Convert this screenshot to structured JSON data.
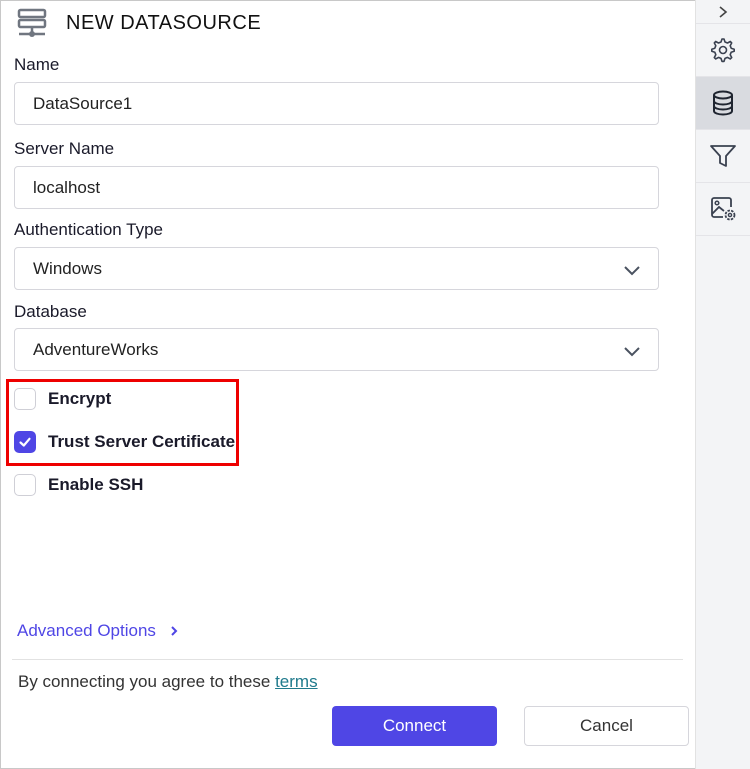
{
  "header": {
    "icon": "datasource-icon",
    "title": "NEW DATASOURCE"
  },
  "form": {
    "name": {
      "label": "Name",
      "value": "DataSource1"
    },
    "server_name": {
      "label": "Server Name",
      "value": "localhost"
    },
    "authentication_type": {
      "label": "Authentication Type",
      "selected": "Windows"
    },
    "database": {
      "label": "Database",
      "selected": "AdventureWorks"
    },
    "checkboxes": [
      {
        "label": "Encrypt",
        "checked": false
      },
      {
        "label": "Trust Server Certificate",
        "checked": true
      },
      {
        "label": "Enable SSH",
        "checked": false
      }
    ]
  },
  "advanced_options": {
    "label": "Advanced Options"
  },
  "terms": {
    "text": "By connecting you agree to these",
    "link": "terms"
  },
  "buttons": {
    "connect": "Connect",
    "cancel": "Cancel"
  },
  "sidebar": {
    "items": [
      {
        "icon": "gear-icon",
        "active": false
      },
      {
        "icon": "database-icon",
        "active": true
      },
      {
        "icon": "filter-icon",
        "active": false
      },
      {
        "icon": "image-settings-icon",
        "active": false
      }
    ]
  },
  "colors": {
    "accent": "#4f46e5",
    "highlight": "#ee0000",
    "link": "#1f7a8c"
  }
}
